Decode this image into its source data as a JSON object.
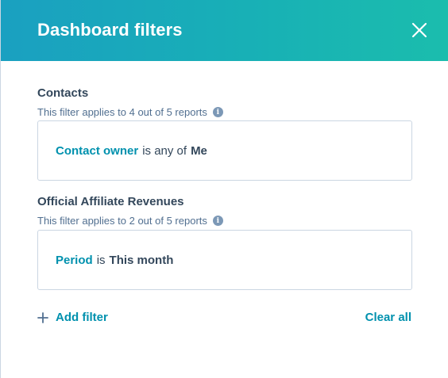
{
  "header": {
    "title": "Dashboard filters",
    "close_icon": "close-icon",
    "gradient_start": "#1aa0c1",
    "gradient_end": "#1bbdad"
  },
  "sections": [
    {
      "title": "Contacts",
      "subtitle": "This filter applies to 4 out of 5 reports",
      "info_icon_label": "i",
      "filter": {
        "property": "Contact owner",
        "operator": "is any of",
        "value": "Me"
      }
    },
    {
      "title": "Official Affiliate Revenues",
      "subtitle": "This filter applies to 2 out of 5 reports",
      "info_icon_label": "i",
      "filter": {
        "property": "Period",
        "operator": "is",
        "value": "This month"
      }
    }
  ],
  "footer": {
    "add_filter_label": "Add filter",
    "clear_all_label": "Clear all"
  },
  "colors": {
    "link": "#0091ae",
    "text": "#33475b",
    "border": "#cbd6e2"
  }
}
